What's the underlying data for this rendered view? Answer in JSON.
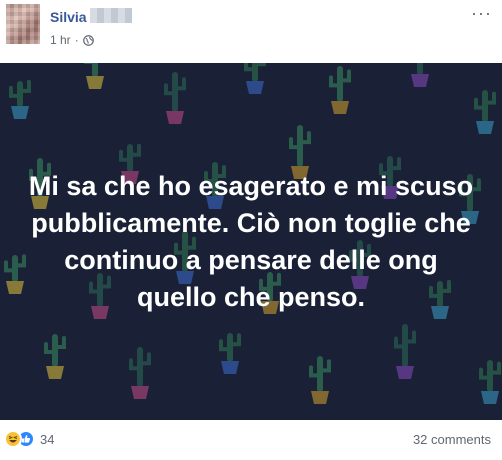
{
  "post": {
    "author": "Silvia",
    "time": "1 hr",
    "separator": "·",
    "privacy_icon": "globe-icon",
    "more_label": "···",
    "text": "Mi sa che ho esagerato e mi scuso pubblicamente. Ciò non toglie che continuo a pensare delle ong quello che penso.",
    "background": {
      "color": "#1a2136",
      "pattern": "cactus-pots"
    }
  },
  "footer": {
    "reaction_icons": [
      "haha-icon",
      "like-icon"
    ],
    "reaction_count": "34",
    "comments": "32 comments"
  },
  "colors": {
    "link": "#385898",
    "meta": "#606770",
    "like": "#2d88ff",
    "haha": "#f7c335"
  }
}
